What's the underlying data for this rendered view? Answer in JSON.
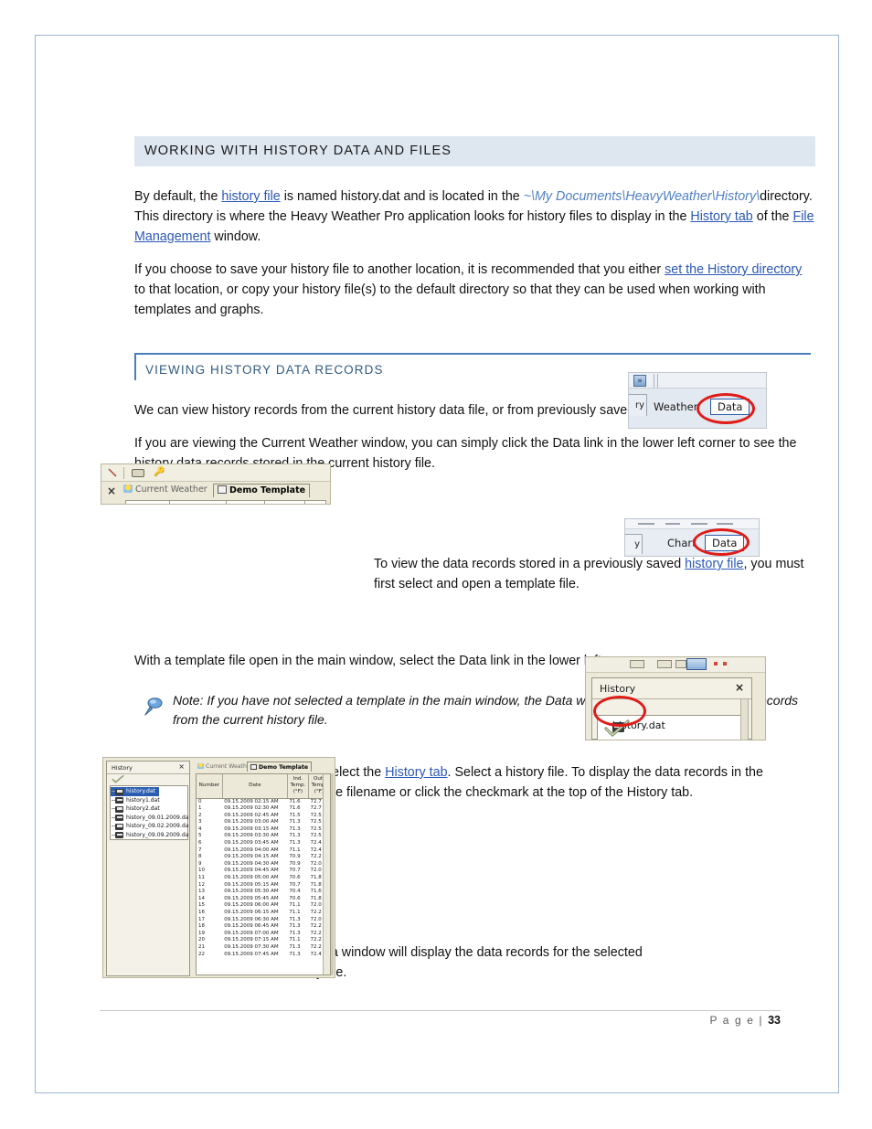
{
  "page": {
    "footer_label": "P a g e  |",
    "footer_number": "33"
  },
  "headings": {
    "h1": "WORKING WITH HISTORY DATA AND FILES",
    "h2": "VIEWING HISTORY DATA RECORDS"
  },
  "paragraphs": {
    "p1_a": "By default, the ",
    "p1_link1": "history file",
    "p1_b": " is named history.dat and is located in the ",
    "p1_path": "~\\My Documents\\HeavyWeather\\History\\",
    "p1_c": "directory. This directory is where the Heavy Weather Pro application looks for history files to display in the ",
    "p1_link2": "History tab",
    "p1_d": " of the ",
    "p1_link3": "File Management",
    "p1_e": " window.",
    "p2_a": "If you choose to save your history file to another location, it is recommended that you either ",
    "p2_link1": "set the History directory",
    "p2_b": " to that location, or copy your history file(s) to the default directory so that they can be used when working with templates and graphs.",
    "p3": "We can view history records from the current history data file, or from previously saved history data files.",
    "p4": "If you are viewing the Current Weather window, you can simply click the Data link in the lower left corner to see the history data records stored in the current history file.",
    "p5_a": "To view the data records stored in a previously saved ",
    "p5_link1": "history file",
    "p5_b": ", you must first select and open a template file.",
    "p6": "With a template file open in the main window, select the Data link in the lower left corner.",
    "note": "Note: If you have not selected a template in the main window, the Data window will only display history records from the current history file.",
    "p7_a": "In the File Management window, select the ",
    "p7_link1": "History tab",
    "p7_b": ". Select a history file. To display the data records in the selected history file, double click the filename or click the checkmark at the top of the History tab.",
    "p8": "The Data window will display the data records for the selected history file."
  },
  "screenshots": {
    "weather_data": {
      "tab_end_label": "ry",
      "weather_label": "Weather",
      "data_label": "Data",
      "arrow_label": "»"
    },
    "template_tabs": {
      "tab_current_weather": "Current Weather",
      "tab_demo_template": "Demo Template",
      "close_label": "×"
    },
    "chart_data": {
      "tab_end_label": "y",
      "chart_label": "Chart",
      "data_label": "Data"
    },
    "history_panel": {
      "title": "History",
      "close_label": "×",
      "file_label": "history.dat"
    },
    "data_window": {
      "left_title": "History",
      "left_close": "×",
      "files": [
        "history.dat",
        "history1.dat",
        "history2.dat",
        "history_09.01.2009.da",
        "history_09.02.2009.da",
        "history_09.09.2009.da"
      ],
      "selected_file_index": 0,
      "tab_current_weather": "Current Weather",
      "tab_demo_template": "Demo Template",
      "columns": [
        "Number",
        "Date",
        "Ind. Temp. (°F)",
        "Out. Temp. (°F)"
      ],
      "column_headers": [
        {
          "line1": "Number",
          "line2": "",
          "line3": ""
        },
        {
          "line1": "Date",
          "line2": "",
          "line3": ""
        },
        {
          "line1": "Ind.",
          "line2": "Temp.",
          "line3": "(°F)"
        },
        {
          "line1": "Out.",
          "line2": "Temp.",
          "line3": "(°F)"
        }
      ],
      "rows": [
        [
          "0",
          "09.15.2009 02:15 AM",
          "71.6",
          "72.7"
        ],
        [
          "1",
          "09.15.2009 02:30 AM",
          "71.6",
          "72.7"
        ],
        [
          "2",
          "09.15.2009 02:45 AM",
          "71.5",
          "72.5"
        ],
        [
          "3",
          "09.15.2009 03:00 AM",
          "71.3",
          "72.5"
        ],
        [
          "4",
          "09.15.2009 03:15 AM",
          "71.3",
          "72.5"
        ],
        [
          "5",
          "09.15.2009 03:30 AM",
          "71.3",
          "72.5"
        ],
        [
          "6",
          "09.15.2009 03:45 AM",
          "71.3",
          "72.4"
        ],
        [
          "7",
          "09.15.2009 04:00 AM",
          "71.1",
          "72.4"
        ],
        [
          "8",
          "09.15.2009 04:15 AM",
          "70.9",
          "72.2"
        ],
        [
          "9",
          "09.15.2009 04:30 AM",
          "70.9",
          "72.0"
        ],
        [
          "10",
          "09.15.2009 04:45 AM",
          "70.7",
          "72.0"
        ],
        [
          "11",
          "09.15.2009 05:00 AM",
          "70.6",
          "71.8"
        ],
        [
          "12",
          "09.15.2009 05:15 AM",
          "70.7",
          "71.8"
        ],
        [
          "13",
          "09.15.2009 05:30 AM",
          "70.4",
          "71.6"
        ],
        [
          "14",
          "09.15.2009 05:45 AM",
          "70.6",
          "71.8"
        ],
        [
          "15",
          "09.15.2009 06:00 AM",
          "71.1",
          "72.0"
        ],
        [
          "16",
          "09.15.2009 06:15 AM",
          "71.1",
          "72.2"
        ],
        [
          "17",
          "09.15.2009 06:30 AM",
          "71.3",
          "72.0"
        ],
        [
          "18",
          "09.15.2009 06:45 AM",
          "71.3",
          "72.2"
        ],
        [
          "19",
          "09.15.2009 07:00 AM",
          "71.3",
          "72.2"
        ],
        [
          "20",
          "09.15.2009 07:15 AM",
          "71.1",
          "72.2"
        ],
        [
          "21",
          "09.15.2009 07:30 AM",
          "71.3",
          "72.2"
        ],
        [
          "22",
          "09.15.2009 07:45 AM",
          "71.3",
          "72.4"
        ]
      ]
    }
  },
  "colors": {
    "heading_band": "#dee6f0",
    "subheading_rule": "#4a7ebb",
    "subheading_text": "#315b82",
    "link": "#2b57b7",
    "italic_link": "#4f7fc8",
    "annotation_red": "#e01b18",
    "page_border": "#9ab4d4"
  }
}
